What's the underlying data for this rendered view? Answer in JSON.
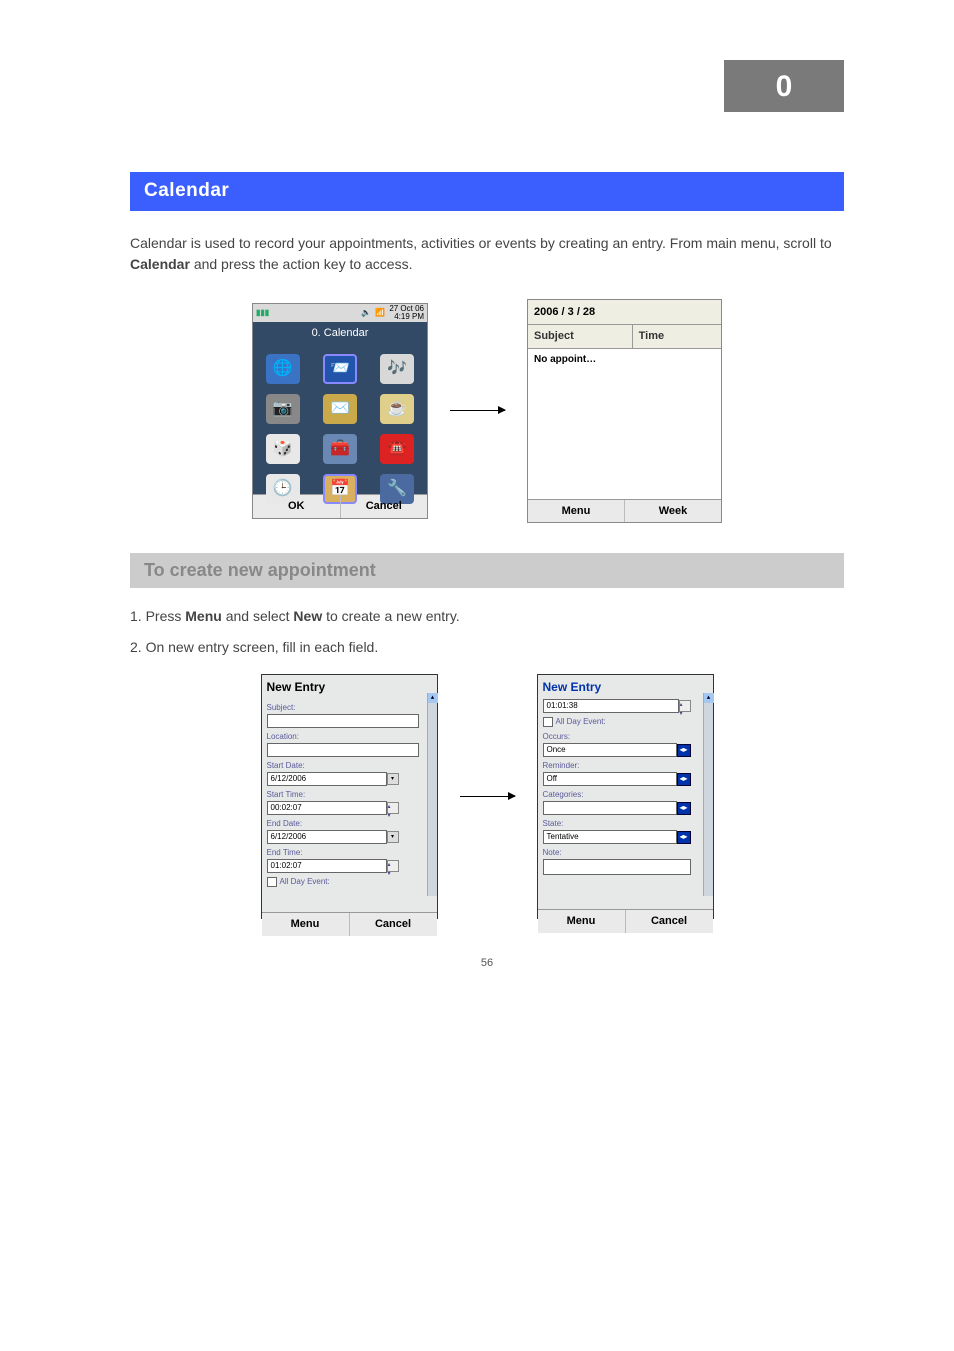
{
  "header": {
    "box": "0"
  },
  "section_title": "Calendar",
  "intro": {
    "p1_prefix": "Calendar is used to record your appointments, activities or events by creating an entry. From main menu, scroll to ",
    "p1_bold": "Calendar",
    "p1_suffix": " and press the action key to access."
  },
  "fig1": {
    "status_date": "27 Oct 06",
    "status_time": "4:19 PM",
    "menu_title": "0. Calendar",
    "softkeys": {
      "left": "OK",
      "right": "Cancel"
    },
    "list_date": "2006 / 3 / 28",
    "col1": "Subject",
    "col2": "Time",
    "row1": "No appoint…",
    "list_soft": {
      "left": "Menu",
      "right": "Week"
    }
  },
  "subheading": "To create new appointment",
  "step1_prefix": "1.  Press ",
  "step1_bold": "Menu",
  "step1_mid": " and select ",
  "step1_bold2": "New",
  "step1_suffix": " to create a new entry.",
  "step2": "2.  On new entry screen, fill in each field.",
  "form_left": {
    "title": "New Entry",
    "subject": "Subject:",
    "location": "Location:",
    "start_date_l": "Start Date:",
    "start_date_v": "6/12/2006",
    "start_time_l": "Start Time:",
    "start_time_v": "00:02:07",
    "end_date_l": "End Date:",
    "end_date_v": "6/12/2006",
    "end_time_l": "End Time:",
    "end_time_v": "01:02:07",
    "all_day": "All Day Event:",
    "soft_left": "Menu",
    "soft_right": "Cancel"
  },
  "form_right": {
    "title": "New Entry",
    "time": "01:01:38",
    "all_day": "All Day Event:",
    "occurs_l": "Occurs:",
    "occurs_v": "Once",
    "reminder_l": "Reminder:",
    "reminder_v": "Off",
    "categories_l": "Categories:",
    "categories_v": "",
    "state_l": "State:",
    "state_v": "Tentative",
    "note_l": "Note:",
    "soft_left": "Menu",
    "soft_right": "Cancel"
  },
  "footer": "56"
}
